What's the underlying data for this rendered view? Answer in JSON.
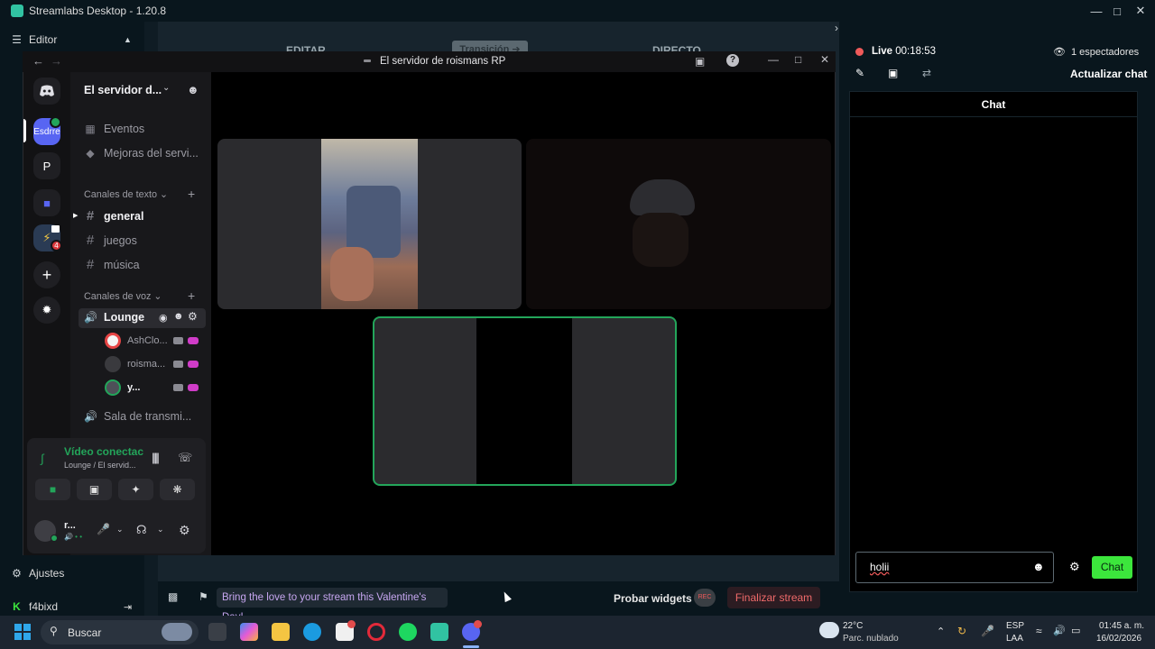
{
  "app": {
    "title": "Streamlabs Desktop - 1.20.8",
    "editor_label": "Editor",
    "ajustes_label": "Ajustes",
    "user_label": "f4bixd",
    "tabs": [
      "EDITAR",
      "Transición ➔",
      "DIRECTO"
    ]
  },
  "stream": {
    "live_label": "Live",
    "live_time": "00:18:53",
    "viewers": "1 espectadores",
    "refresh_chat": "Actualizar chat",
    "chat_title": "Chat",
    "chat_input_value": "holii",
    "chat_send": "Chat"
  },
  "bottom_bar": {
    "banner": "Bring the love to your stream this Valentine's Day!",
    "test_widgets": "Probar widgets",
    "rec": "REC",
    "end_stream": "Finalizar stream"
  },
  "discord": {
    "window_title": "El servidor de roismans RP",
    "server_name": "El servidor d...",
    "guilds": [
      "Esdrre",
      "P"
    ],
    "guild_badge": "4",
    "events": "Eventos",
    "boosts": "Mejoras del servi...",
    "text_category": "Canales de texto",
    "text_channels": [
      "general",
      "juegos",
      "música"
    ],
    "voice_category": "Canales de voz",
    "voice_channel": "Lounge",
    "members": [
      "AshClo...",
      "roisma...",
      "y..."
    ],
    "stage_channel": "Sala de transmi...",
    "vc_status": "Vídeo conectac",
    "vc_location": "Lounge / El servid...",
    "user_name": "r..."
  },
  "taskbar": {
    "search_placeholder": "Buscar",
    "weather_temp": "22°C",
    "weather_desc": "Parc. nublado",
    "lang1": "ESP",
    "lang2": "LAA",
    "time": "01:45 a. m.",
    "date": "16/02/2026"
  },
  "colors": {
    "accent_green": "#3ce63c",
    "live_red": "#ef5a5a",
    "discord_blurple": "#5865f2",
    "stream_pink": "#d03cc8",
    "teal": "#31c3a2"
  }
}
